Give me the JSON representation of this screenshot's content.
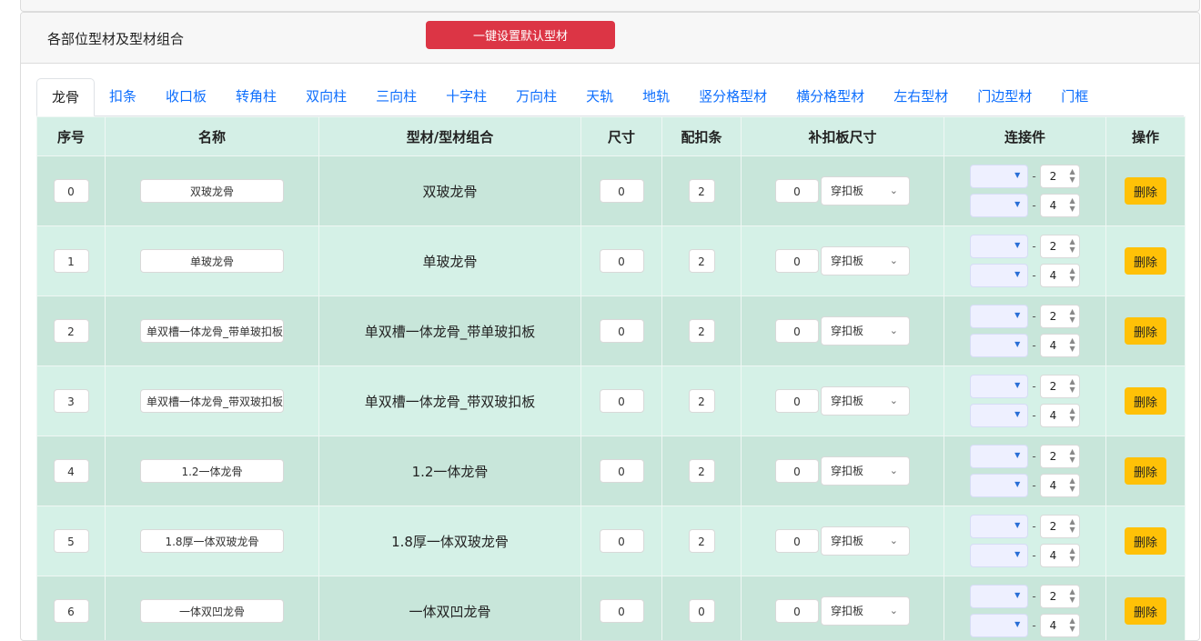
{
  "header": {
    "title": "各部位型材及型材组合",
    "default_button": "一键设置默认型材"
  },
  "tabs": [
    "龙骨",
    "扣条",
    "收口板",
    "转角柱",
    "双向柱",
    "三向柱",
    "十字柱",
    "万向柱",
    "天轨",
    "地轨",
    "竖分格型材",
    "横分格型材",
    "左右型材",
    "门边型材",
    "门框"
  ],
  "active_tab": "龙骨",
  "table": {
    "columns": [
      "序号",
      "名称",
      "型材/型材组合",
      "尺寸",
      "配扣条",
      "补扣板尺寸",
      "连接件",
      "操作"
    ],
    "rows": [
      {
        "idx": "0",
        "name": "双玻龙骨",
        "combo": "双玻龙骨",
        "size": "0",
        "pei": "2",
        "bu": "0",
        "bu_type": "穿扣板",
        "c1": "2",
        "c2": "4",
        "action": "删除"
      },
      {
        "idx": "1",
        "name": "单玻龙骨",
        "combo": "单玻龙骨",
        "size": "0",
        "pei": "2",
        "bu": "0",
        "bu_type": "穿扣板",
        "c1": "2",
        "c2": "4",
        "action": "删除"
      },
      {
        "idx": "2",
        "name": "单双槽一体龙骨_带单玻扣板",
        "combo": "单双槽一体龙骨_带单玻扣板",
        "size": "0",
        "pei": "2",
        "bu": "0",
        "bu_type": "穿扣板",
        "c1": "2",
        "c2": "4",
        "action": "删除"
      },
      {
        "idx": "3",
        "name": "单双槽一体龙骨_带双玻扣板",
        "combo": "单双槽一体龙骨_带双玻扣板",
        "size": "0",
        "pei": "2",
        "bu": "0",
        "bu_type": "穿扣板",
        "c1": "2",
        "c2": "4",
        "action": "删除"
      },
      {
        "idx": "4",
        "name": "1.2一体龙骨",
        "combo": "1.2一体龙骨",
        "size": "0",
        "pei": "2",
        "bu": "0",
        "bu_type": "穿扣板",
        "c1": "2",
        "c2": "4",
        "action": "删除"
      },
      {
        "idx": "5",
        "name": "1.8厚一体双玻龙骨",
        "combo": "1.8厚一体双玻龙骨",
        "size": "0",
        "pei": "2",
        "bu": "0",
        "bu_type": "穿扣板",
        "c1": "2",
        "c2": "4",
        "action": "删除"
      },
      {
        "idx": "6",
        "name": "一体双凹龙骨",
        "combo": "一体双凹龙骨",
        "size": "0",
        "pei": "0",
        "bu": "0",
        "bu_type": "穿扣板",
        "c1": "2",
        "c2": "4",
        "action": "删除"
      }
    ]
  },
  "colors": {
    "danger": "#dc3545",
    "warning": "#ffc107",
    "link": "#0d6efd",
    "row_odd": "#c8e6da",
    "row_even": "#d5f1e7",
    "header_bg": "#d4efe6"
  },
  "icons": {
    "select_arrow": "chevron-down-icon",
    "connector_caret": "caret-down-icon",
    "spinner": "spinner-arrows-icon"
  }
}
